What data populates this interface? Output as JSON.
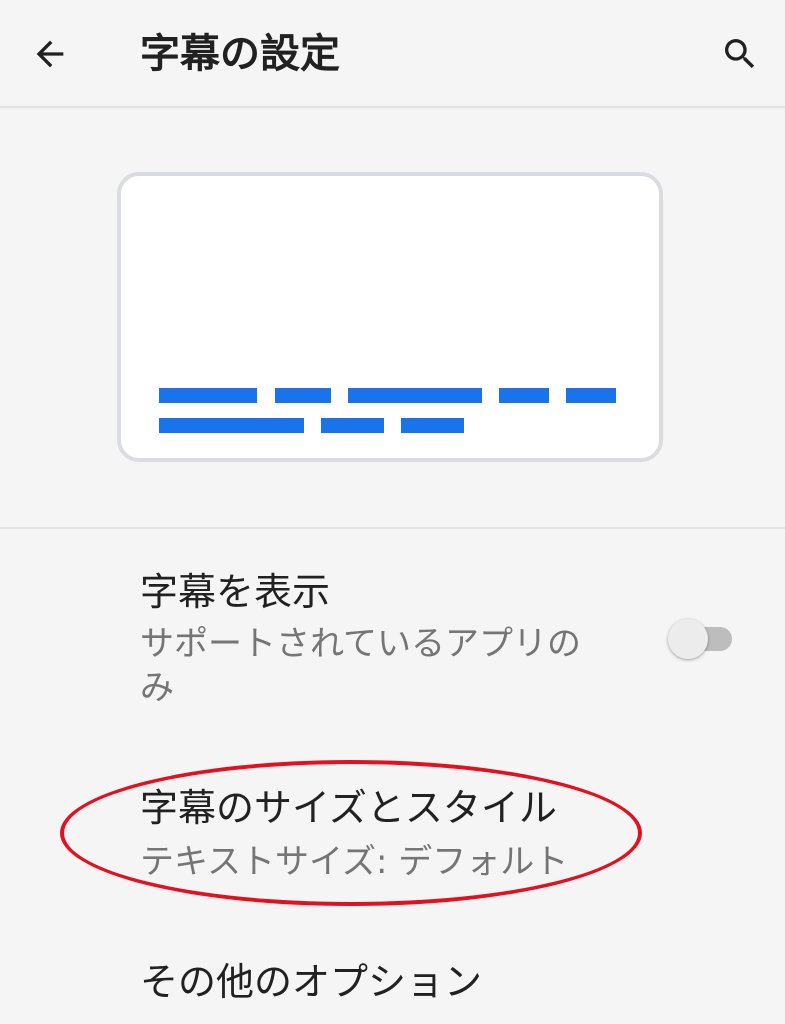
{
  "header": {
    "title": "字幕の設定",
    "back_icon": "arrow-back-icon",
    "search_icon": "search-icon"
  },
  "preview": {
    "caption_color": "#1a73e8"
  },
  "settings": {
    "show_captions": {
      "title": "字幕を表示",
      "summary": "サポートされているアプリのみ",
      "enabled": false
    },
    "caption_style": {
      "title": "字幕のサイズとスタイル",
      "summary": "テキストサイズ: デフォルト"
    },
    "more_options": {
      "title": "その他のオプション"
    }
  },
  "colors": {
    "accent": "#1a73e8",
    "highlight_annotation": "#e3101f"
  }
}
